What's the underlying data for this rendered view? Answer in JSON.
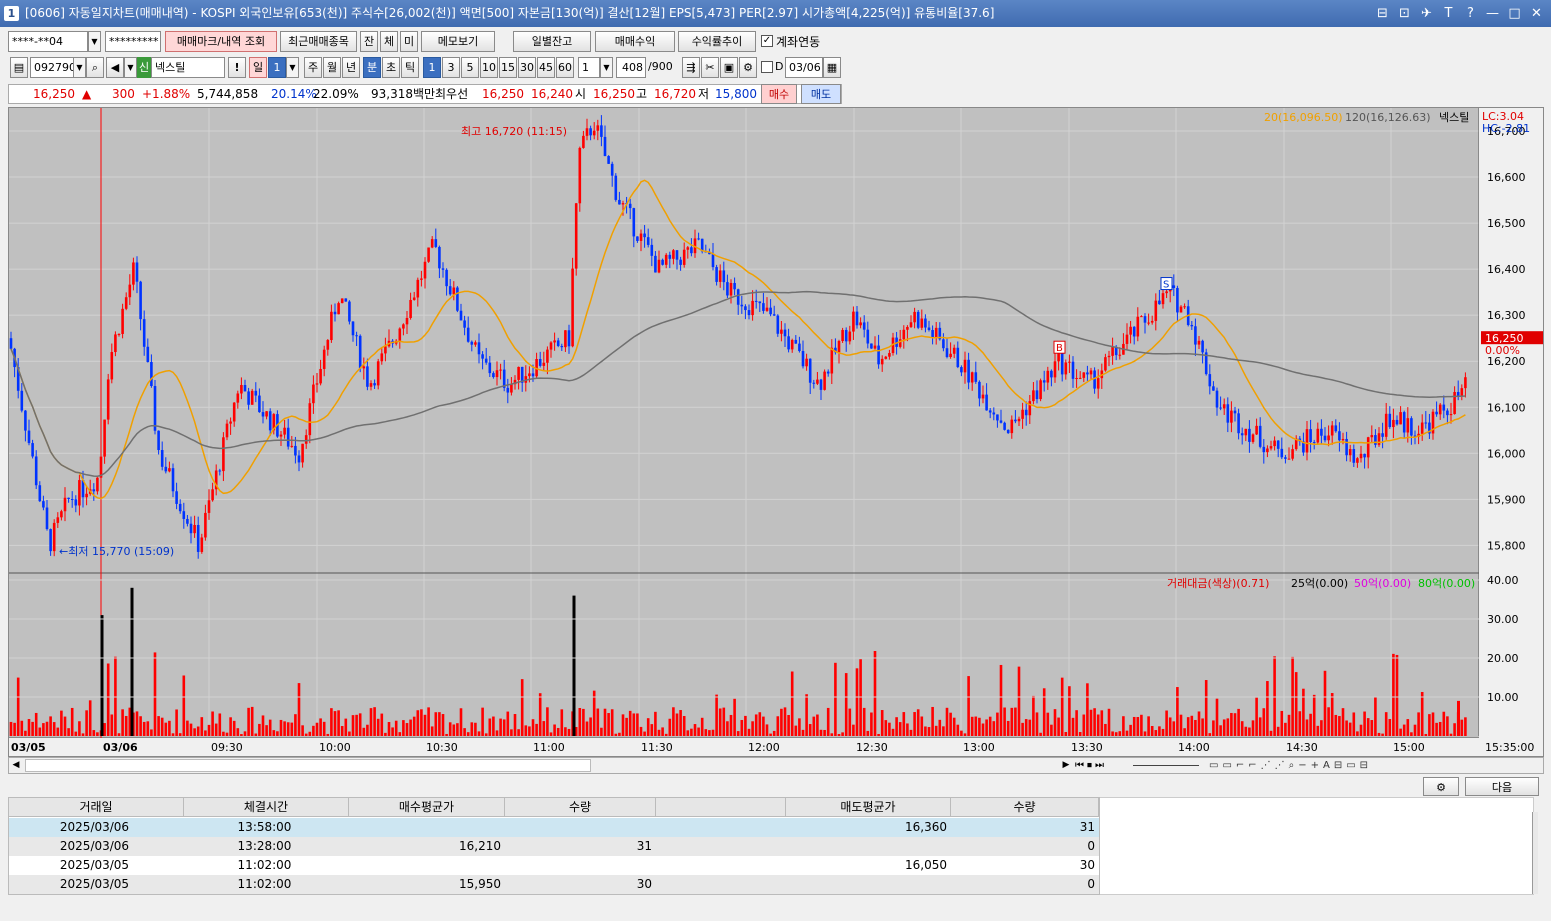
{
  "window": {
    "app_icon": "1",
    "title": "[0606] 자동일지차트(매매내역) - KOSPI 외국인보유[653(천)] 주식수[26,002(천)] 액면[500] 자본금[130(억)] 결산[12월] EPS[5,473] PER[2.97] 시가총액[4,225(억)] 유통비율[37.6]",
    "controls": [
      "⊟",
      "⊡",
      "✈",
      "T",
      "?",
      "—",
      "□",
      "✕"
    ]
  },
  "toolbar1": {
    "account": "****-**04",
    "password": "*********",
    "mark_button": "매매마크/내역 조회",
    "recent_button": "최근매매종목",
    "btn_jan": "잔",
    "btn_che": "체",
    "btn_mi": "미",
    "memo_button": "메모보기",
    "daily_button": "일별잔고",
    "profit_button": "매매수익",
    "trend_button": "수익률추이",
    "link_label": "계좌연동",
    "link_checked": "✓"
  },
  "toolbar2": {
    "code": "092790",
    "credit_badge": "신",
    "stock_name": "넥스틸",
    "excl": "!",
    "period_il": "일",
    "period_num": "1",
    "ju": "주",
    "wol": "월",
    "nyeon": "년",
    "bun": "분",
    "cho": "초",
    "tick": "틱",
    "intervals": [
      "1",
      "3",
      "5",
      "10",
      "15",
      "30",
      "45",
      "60"
    ],
    "custom": "1",
    "count": "408",
    "count_total": "/900",
    "d_label": "D",
    "date": "03/06"
  },
  "quote": {
    "price": "16,250",
    "arrow": "▲",
    "change": "300",
    "rate": "+1.88%",
    "volume": "5,744,858",
    "vol_rate": "20.14%",
    "turnover": "22.09%",
    "amount": "93,318백만",
    "best_label": "최우선",
    "best_ask": "16,250",
    "best_bid": "16,240",
    "open_label": "시",
    "open": "16,250",
    "high_label": "고",
    "high": "16,720",
    "low_label": "저",
    "low": "15,800",
    "buy_button": "매수",
    "sell_button": "매도"
  },
  "chart": {
    "legend_ma20": "20(16,096.50)",
    "legend_ma120": "120(16,126.63)",
    "legend_name": "넥스틸",
    "lc": "LC:3.04",
    "hc": "HC:-2.81",
    "high_annotation": "최고 16,720 (11:15)",
    "low_annotation": "←최저 15,770 (15:09)",
    "current_price_tag": "16,250",
    "current_rate_tag": "0.00%",
    "buy_marker": "B",
    "sell_marker": "S",
    "vol_legend_title": "거래대금(색상)(0.71)",
    "vol_legend_25": "25억(0.00)",
    "vol_legend_50": "50억(0.00)",
    "vol_legend_80": "80억(0.00)",
    "time_readout": "15:35:00",
    "colors": {
      "up": "#ff0000",
      "down": "#0033ff",
      "ma20": "#f0a000",
      "ma120": "#707070",
      "bg": "#c0c0c0"
    }
  },
  "chart_data": {
    "type": "candlestick",
    "price_axis": [
      "16,700",
      "16,600",
      "16,500",
      "16,400",
      "16,300",
      "16,200",
      "16,100",
      "16,000",
      "15,900",
      "15,800"
    ],
    "ylim": [
      15740,
      16750
    ],
    "volume_axis": [
      "40.00",
      "30.00",
      "20.00",
      "10.00"
    ],
    "time_labels": [
      "03/05",
      "03/06",
      "09:30",
      "10:00",
      "10:30",
      "11:00",
      "11:30",
      "12:00",
      "12:30",
      "13:00",
      "13:30",
      "14:00",
      "14:30",
      "15:00"
    ],
    "high": 16720,
    "low": 15770,
    "last": 16250
  },
  "table": {
    "headers": [
      "거래일",
      "체결시간",
      "매수평균가",
      "수량",
      "",
      "매도평균가",
      "수량"
    ],
    "rows": [
      [
        "2025/03/06",
        "13:58:00",
        "",
        "",
        "",
        "16,360",
        "31"
      ],
      [
        "2025/03/06",
        "13:28:00",
        "16,210",
        "31",
        "",
        "",
        "0"
      ],
      [
        "2025/03/05",
        "11:02:00",
        "",
        "",
        "",
        "16,050",
        "30"
      ],
      [
        "2025/03/05",
        "11:02:00",
        "15,950",
        "30",
        "",
        "",
        "0"
      ]
    ],
    "next_button": "다음"
  }
}
